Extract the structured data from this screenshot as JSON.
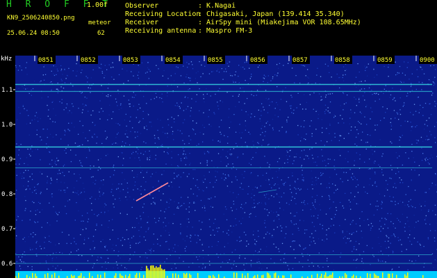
{
  "header": {
    "brand": "H R O F F T",
    "version": "1.00f",
    "filename": "KN9_2506240850.png",
    "meteor_label": "meteor",
    "datetime": "25.06.24 08:50",
    "meteor_count": "62",
    "info": [
      {
        "label": "Observer",
        "value": ": K.Nagai"
      },
      {
        "label": "Receiving Location",
        "value": ": Chigasaki, Japan (139.414 35.340)"
      },
      {
        "label": "Receiver",
        "value": ": AirSpy mini (Miakejima VOR 108.65MHz)"
      },
      {
        "label": "Receiving antenna",
        "value": ": Maspro FM-3"
      }
    ]
  },
  "spectrogram": {
    "unit": "kHz",
    "time_labels": [
      "0851",
      "0852",
      "0853",
      "0854",
      "0855",
      "0856",
      "0857",
      "0858",
      "0859",
      "0900"
    ],
    "freq_labels": [
      "1.1",
      "1.0",
      "0.9",
      "0.8",
      "0.7",
      "0.6"
    ],
    "freq_values": [
      1.1,
      1.0,
      0.9,
      0.8,
      0.7,
      0.6
    ],
    "background_color": "#0a1a88",
    "trace_color": "#33ccdd",
    "activity_color": "#ffff00",
    "bottom_band_color": "#00ccff"
  }
}
